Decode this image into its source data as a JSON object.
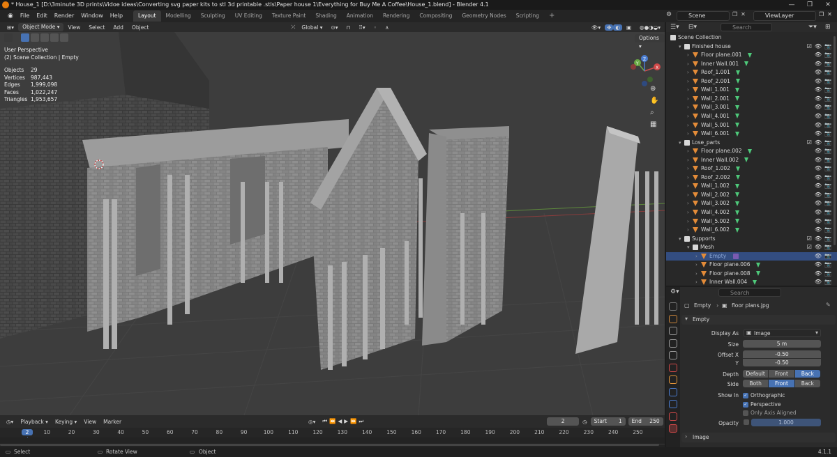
{
  "window": {
    "title": "* House_1 [D:\\3minute 3D prints\\Vidoe ideas\\Converting svg paper kits to stl 3d printable .stls\\Paper house 1\\Everything for Buy Me A Coffee\\House_1.blend] - Blender 4.1",
    "controls": [
      "—",
      "❐",
      "✕"
    ]
  },
  "menu": {
    "items": [
      "File",
      "Edit",
      "Render",
      "Window",
      "Help"
    ],
    "workspaces": [
      "Layout",
      "Modelling",
      "Sculpting",
      "UV Editing",
      "Texture Paint",
      "Shading",
      "Animation",
      "Rendering",
      "Compositing",
      "Geometry Nodes",
      "Scripting"
    ],
    "active_workspace": "Layout",
    "add_tab": "+",
    "scene": "Scene",
    "view_layer": "ViewLayer"
  },
  "viewport_header": {
    "mode": "Object Mode",
    "items": [
      "View",
      "Select",
      "Add",
      "Object"
    ],
    "orientation": "Global",
    "options": "Options"
  },
  "viewport": {
    "view_name": "User Perspective",
    "collection_path": "(2) Scene Collection | Empty",
    "stats": [
      {
        "label": "Objects",
        "value": "29"
      },
      {
        "label": "Vertices",
        "value": "987,443"
      },
      {
        "label": "Edges",
        "value": "1,999,098"
      },
      {
        "label": "Faces",
        "value": "1,022,247"
      },
      {
        "label": "Triangles",
        "value": "1,953,657"
      }
    ],
    "gizmo_axes": [
      "X",
      "Y",
      "Z"
    ]
  },
  "timeline": {
    "menu": [
      "Playback",
      "Keying",
      "View",
      "Marker"
    ],
    "current_frame": "2",
    "start_label": "Start",
    "start": "1",
    "end_label": "End",
    "end": "250",
    "ruler": [
      "2",
      "10",
      "20",
      "30",
      "40",
      "50",
      "60",
      "70",
      "80",
      "90",
      "100",
      "110",
      "120",
      "130",
      "140",
      "150",
      "160",
      "170",
      "180",
      "190",
      "200",
      "210",
      "220",
      "230",
      "240",
      "250"
    ]
  },
  "statusbar": {
    "left": "Select",
    "middle": "Rotate View",
    "right": "Object",
    "version": "4.1.1"
  },
  "outliner": {
    "search_placeholder": "Search",
    "rows": [
      {
        "label": "Scene Collection",
        "kind": "root"
      },
      {
        "label": "Finished house",
        "kind": "collection"
      },
      {
        "label": "Floor plane.001",
        "kind": "object"
      },
      {
        "label": "Inner Wall.001",
        "kind": "object"
      },
      {
        "label": "Roof_1.001",
        "kind": "object"
      },
      {
        "label": "Roof_2.001",
        "kind": "object"
      },
      {
        "label": "Wall_1.001",
        "kind": "object"
      },
      {
        "label": "Wall_2.001",
        "kind": "object"
      },
      {
        "label": "Wall_3.001",
        "kind": "object"
      },
      {
        "label": "Wall_4.001",
        "kind": "object"
      },
      {
        "label": "Wall_5.001",
        "kind": "object"
      },
      {
        "label": "Wall_6.001",
        "kind": "object"
      },
      {
        "label": "Lose_parts",
        "kind": "collection"
      },
      {
        "label": "Floor plane.002",
        "kind": "object"
      },
      {
        "label": "Inner Wall.002",
        "kind": "object"
      },
      {
        "label": "Roof_1.002",
        "kind": "object"
      },
      {
        "label": "Roof_2.002",
        "kind": "object"
      },
      {
        "label": "Wall_1.002",
        "kind": "object"
      },
      {
        "label": "Wall_2.002",
        "kind": "object"
      },
      {
        "label": "Wall_3.002",
        "kind": "object"
      },
      {
        "label": "Wall_4.002",
        "kind": "object"
      },
      {
        "label": "Wall_5.002",
        "kind": "object"
      },
      {
        "label": "Wall_6.002",
        "kind": "object"
      },
      {
        "label": "Supports",
        "kind": "collection"
      },
      {
        "label": "Mesh",
        "kind": "subcollection"
      },
      {
        "label": "Empty",
        "kind": "selected"
      },
      {
        "label": "Floor plane.006",
        "kind": "object2"
      },
      {
        "label": "Floor plane.008",
        "kind": "object2"
      },
      {
        "label": "Inner Wall.004",
        "kind": "object2"
      }
    ]
  },
  "properties": {
    "search_placeholder": "Search",
    "breadcrumb_object": "Empty",
    "breadcrumb_data": "floor plans.jpg",
    "panel_title": "Empty",
    "display_as_label": "Display As",
    "display_as_value": "Image",
    "size_label": "Size",
    "size_value": "5 m",
    "offset_x_label": "Offset X",
    "offset_x_value": "-0.50",
    "offset_y_label": "Y",
    "offset_y_value": "-0.50",
    "depth_label": "Depth",
    "depth_options": [
      "Default",
      "Front",
      "Back"
    ],
    "depth_selected": "Back",
    "side_label": "Side",
    "side_options": [
      "Both",
      "Front",
      "Back"
    ],
    "side_selected": "Front",
    "show_in_label": "Show In",
    "show_in": [
      {
        "label": "Orthographic",
        "checked": true
      },
      {
        "label": "Perspective",
        "checked": true
      },
      {
        "label": "Only Axis Aligned",
        "checked": false
      }
    ],
    "opacity_label": "Opacity",
    "opacity_value": "1.000",
    "image_panel_title": "Image"
  },
  "colors": {
    "accent": "#4772b3",
    "selection": "#334d80",
    "object_icon": "#e38b38",
    "mesh_icon": "#4ec97a",
    "viewport_bg": "#3d3d3d",
    "playhead": "#4772b3"
  }
}
